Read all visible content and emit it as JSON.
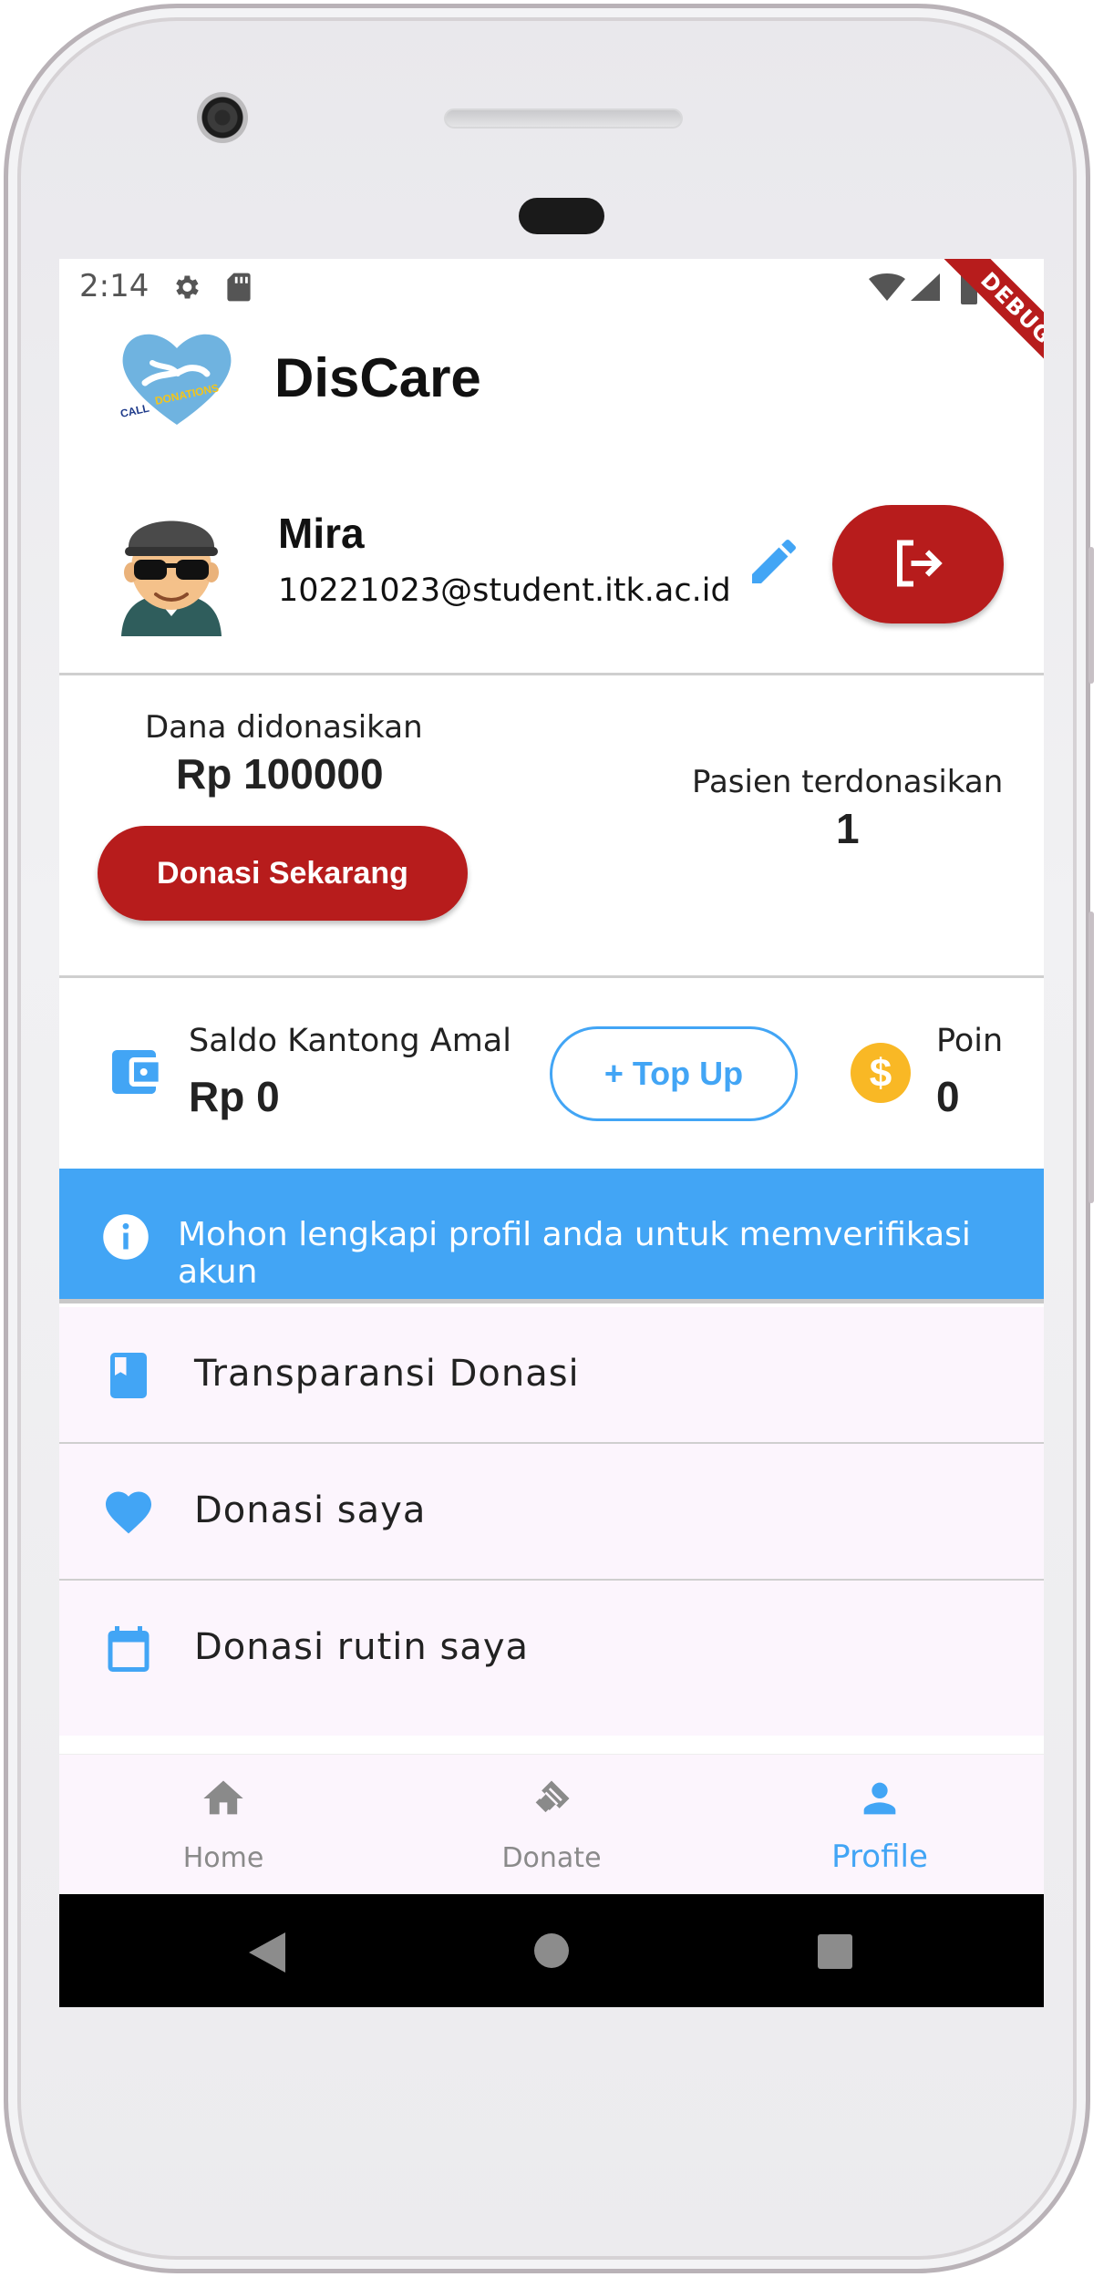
{
  "status_bar": {
    "time": "2:14",
    "debug_label": "DEBUG"
  },
  "app": {
    "title": "DisCare",
    "logo_text": "CALL for DONATIONS"
  },
  "profile": {
    "name": "Mira",
    "email": "10221023@student.itk.ac.id"
  },
  "donation_stats": {
    "funds_label": "Dana didonasikan",
    "funds_value": "Rp 100000",
    "donate_button": "Donasi Sekarang",
    "patients_label": "Pasien terdonasikan",
    "patients_value": "1"
  },
  "wallet": {
    "label": "Saldo Kantong Amal",
    "value": "Rp 0",
    "topup_button": "+ Top Up",
    "points_label": "Poin",
    "points_value": "0"
  },
  "info_banner": {
    "text": "Mohon lengkapi profil anda untuk memverifikasi akun"
  },
  "menu": {
    "items": [
      {
        "label": "Transparansi Donasi",
        "icon": "book-icon"
      },
      {
        "label": "Donasi saya",
        "icon": "heart-icon"
      },
      {
        "label": "Donasi rutin saya",
        "icon": "calendar-icon"
      }
    ]
  },
  "bottom_nav": {
    "items": [
      {
        "label": "Home",
        "icon": "home-icon",
        "active": false
      },
      {
        "label": "Donate",
        "icon": "handshake-icon",
        "active": false
      },
      {
        "label": "Profile",
        "icon": "person-icon",
        "active": true
      }
    ]
  },
  "colors": {
    "primary_red": "#b71c1c",
    "accent_blue": "#42a5f5",
    "coin_yellow": "#f9b825",
    "menu_background": "#fcf5fd"
  }
}
